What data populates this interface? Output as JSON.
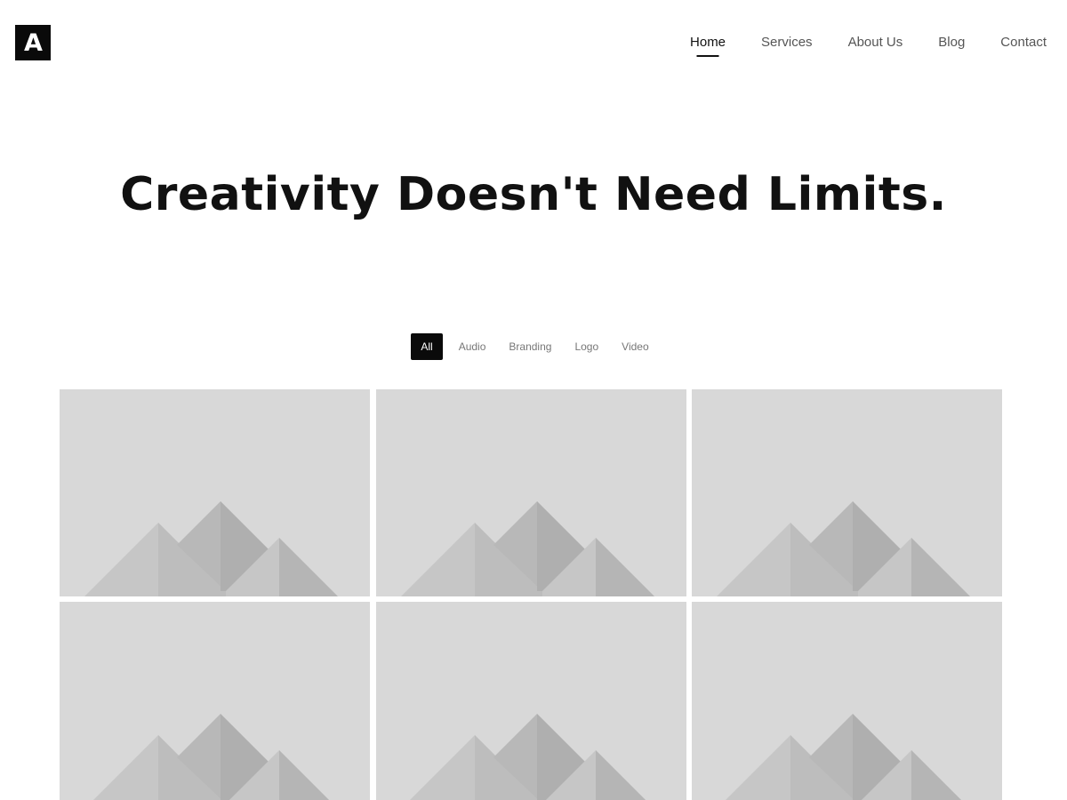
{
  "logo": {
    "letter": "A"
  },
  "nav": {
    "items": [
      {
        "label": "Home",
        "active": true
      },
      {
        "label": "Services",
        "active": false
      },
      {
        "label": "About Us",
        "active": false
      },
      {
        "label": "Blog",
        "active": false
      },
      {
        "label": "Contact",
        "active": false
      }
    ]
  },
  "hero": {
    "title": "Creativity Doesn't Need Limits."
  },
  "filters": {
    "items": [
      {
        "label": "All",
        "active": true
      },
      {
        "label": "Audio",
        "active": false
      },
      {
        "label": "Branding",
        "active": false
      },
      {
        "label": "Logo",
        "active": false
      },
      {
        "label": "Video",
        "active": false
      }
    ]
  },
  "portfolio": {
    "tiles": [
      {
        "icon": "image-placeholder-icon"
      },
      {
        "icon": "image-placeholder-icon"
      },
      {
        "icon": "image-placeholder-icon"
      },
      {
        "icon": "image-placeholder-icon"
      },
      {
        "icon": "image-placeholder-icon"
      },
      {
        "icon": "image-placeholder-icon"
      }
    ]
  },
  "colors": {
    "accent": "#0a0a0a",
    "placeholder_bg": "#d8d8d8"
  }
}
